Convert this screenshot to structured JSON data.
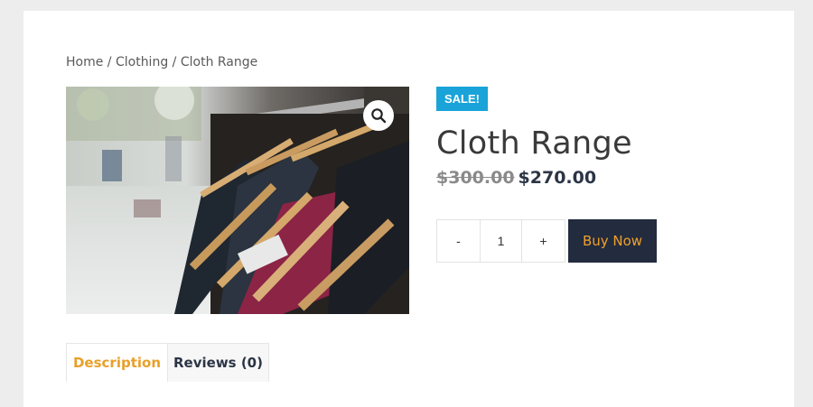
{
  "breadcrumb": {
    "home": "Home",
    "sep1": " / ",
    "category": "Clothing",
    "sep2": " / ",
    "current": "Cloth Range"
  },
  "product": {
    "badge": "SALE!",
    "title": "Cloth Range",
    "price_old": "$300.00",
    "price_new": "$270.00",
    "zoom_icon": "magnifier-icon"
  },
  "quantity": {
    "minus_label": "-",
    "value": "1",
    "plus_label": "+"
  },
  "buy_button": {
    "label": "Buy Now"
  },
  "tabs": [
    {
      "label": "Description",
      "active": true
    },
    {
      "label": "Reviews (0)",
      "active": false
    }
  ],
  "colors": {
    "sale_badge": "#1aa3d9",
    "buy_bg": "#232b3e",
    "buy_text": "#f0a12b",
    "active_tab_text": "#e8a02a"
  }
}
